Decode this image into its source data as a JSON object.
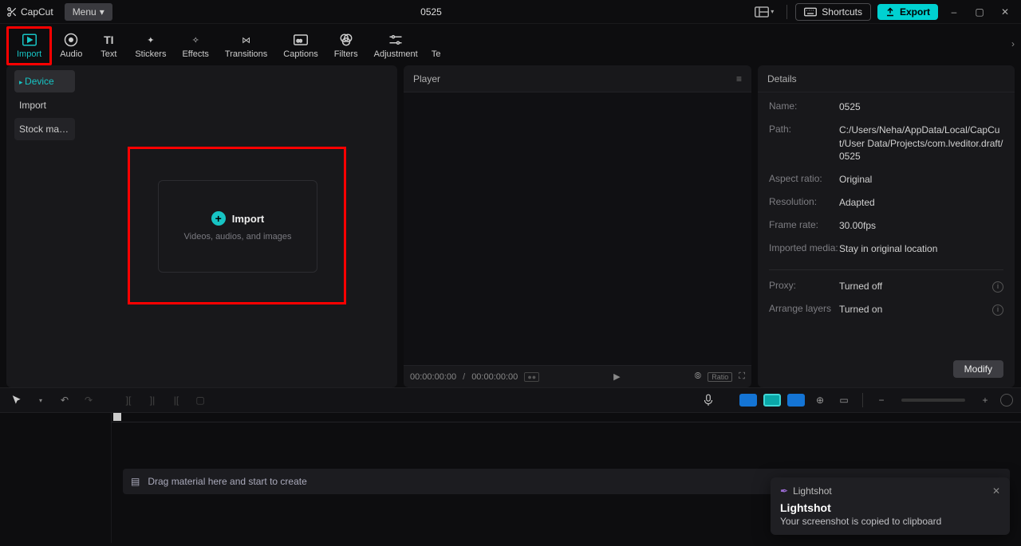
{
  "app": {
    "name": "CapCut",
    "project_title": "0525"
  },
  "menu": {
    "label": "Menu"
  },
  "titlebar": {
    "shortcuts": "Shortcuts",
    "export": "Export"
  },
  "tabs": {
    "import": "Import",
    "audio": "Audio",
    "text": "Text",
    "stickers": "Stickers",
    "effects": "Effects",
    "transitions": "Transitions",
    "captions": "Captions",
    "filters": "Filters",
    "adjustment": "Adjustment",
    "templates": "Te"
  },
  "media_side": {
    "device": "Device",
    "import": "Import",
    "stock": "Stock mater..."
  },
  "import_zone": {
    "title": "Import",
    "subtitle": "Videos, audios, and images"
  },
  "player": {
    "title": "Player",
    "time_current": "00:00:00:00",
    "time_total": "00:00:00:00",
    "ratio_label": "Ratio"
  },
  "details": {
    "title": "Details",
    "rows": {
      "name_label": "Name:",
      "name_value": "0525",
      "path_label": "Path:",
      "path_value": "C:/Users/Neha/AppData/Local/CapCut/User Data/Projects/com.lveditor.draft/0525",
      "aspect_label": "Aspect ratio:",
      "aspect_value": "Original",
      "res_label": "Resolution:",
      "res_value": "Adapted",
      "fps_label": "Frame rate:",
      "fps_value": "30.00fps",
      "media_label": "Imported media:",
      "media_value": "Stay in original location",
      "proxy_label": "Proxy:",
      "proxy_value": "Turned off",
      "layers_label": "Arrange layers",
      "layers_value": "Turned on"
    },
    "modify": "Modify"
  },
  "timeline": {
    "drop_text": "Drag material here and start to create"
  },
  "toast": {
    "app": "Lightshot",
    "title": "Lightshot",
    "body": "Your screenshot is copied to clipboard"
  }
}
